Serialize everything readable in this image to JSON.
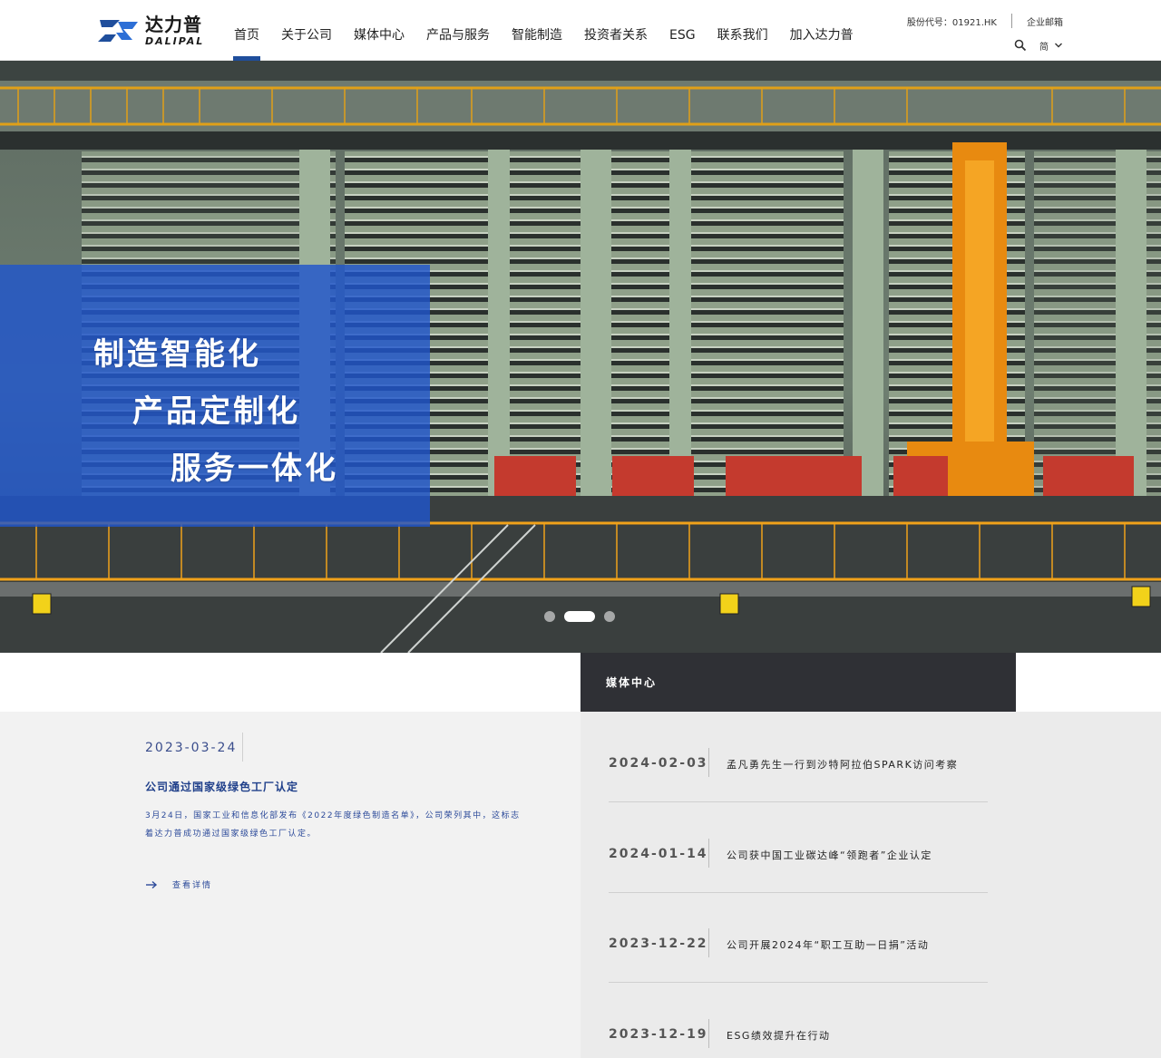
{
  "brand": {
    "name_cn": "达力普",
    "name_en": "DALIPAL"
  },
  "nav": {
    "items": [
      {
        "label": "首页",
        "active": true
      },
      {
        "label": "关于公司"
      },
      {
        "label": "媒体中心"
      },
      {
        "label": "产品与服务"
      },
      {
        "label": "智能制造"
      },
      {
        "label": "投资者关系"
      },
      {
        "label": "ESG"
      },
      {
        "label": "联系我们"
      },
      {
        "label": "加入达力普"
      }
    ]
  },
  "top": {
    "stock_code": "股份代号：01921.HK",
    "mail": "企业邮箱",
    "language": "简",
    "icons": [
      "search-icon",
      "chevron-down-icon"
    ]
  },
  "hero": {
    "slogans": [
      "制造智能化",
      "产品定制化",
      "服务一体化"
    ],
    "carousel": {
      "slides": 3,
      "active_index": 1
    }
  },
  "featured": {
    "date": "2023-03-24",
    "title": "公司通过国家级绿色工厂认定",
    "body": "3月24日，国家工业和信息化部发布《2022年度绿色制造名单》，公司荣列其中，这标志着达力普成功通过国家级绿色工厂认定。",
    "more_label": "查看详情"
  },
  "media": {
    "title": "媒体中心",
    "news": [
      {
        "date": "2024-02-03",
        "title": "孟凡勇先生一行到沙特阿拉伯SPARK访问考察"
      },
      {
        "date": "2024-01-14",
        "title": "公司获中国工业碳达峰“领跑者”企业认定"
      },
      {
        "date": "2023-12-22",
        "title": "公司开展2024年“职工互助一日捐”活动"
      },
      {
        "date": "2023-12-19",
        "title": "ESG绩效提升在行动"
      }
    ]
  },
  "colors": {
    "accent": "#1f4e9c",
    "panel": "#2056cc",
    "media_head": "#2f3035"
  }
}
